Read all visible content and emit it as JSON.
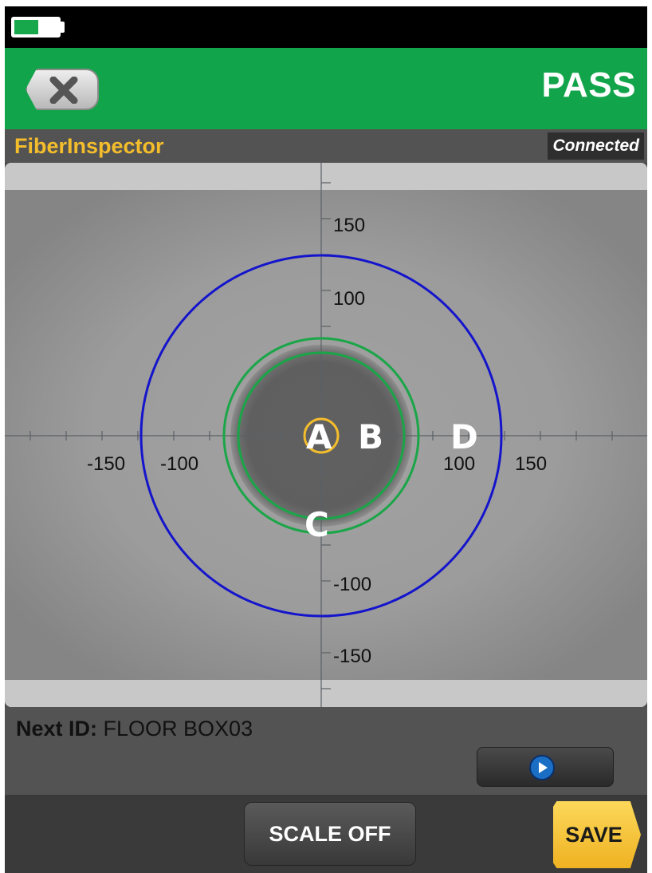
{
  "status_bar": {
    "battery_level": 0.55,
    "battery_color": "#16a84a"
  },
  "header": {
    "close_icon": "close-x-icon",
    "result": "PASS",
    "color": "#12a44a"
  },
  "titlebar": {
    "app_title": "FiberInspector",
    "connection_status": "Connected"
  },
  "fiber_view": {
    "x_tick_labels": [
      "-150",
      "-100",
      "100",
      "150"
    ],
    "y_tick_labels": [
      "150",
      "100",
      "-100",
      "-150"
    ],
    "zones": [
      "A",
      "B",
      "C",
      "D"
    ],
    "zone_colors": {
      "A": "#f4bd2c",
      "inner": "#1aa648",
      "outer": "#1414cc"
    }
  },
  "footer": {
    "next_id_label": "Next ID:",
    "next_id_value": "FLOOR BOX03",
    "play_icon": "play-icon",
    "scale_button": "SCALE OFF",
    "save_button": "SAVE"
  }
}
